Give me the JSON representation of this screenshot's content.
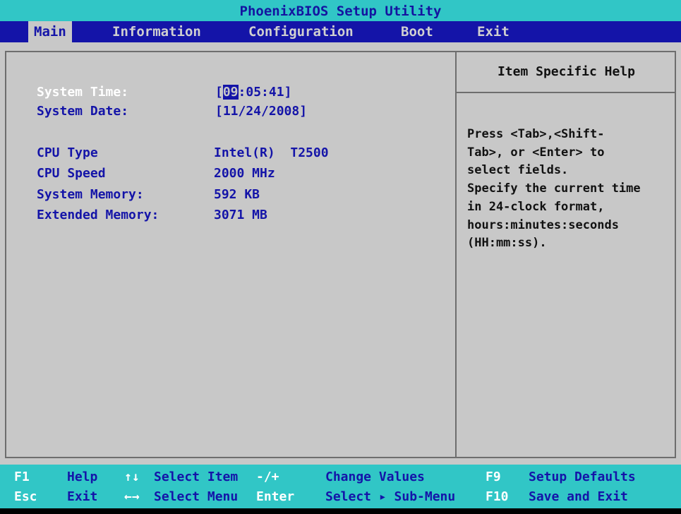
{
  "title": "PhoenixBIOS Setup Utility",
  "menu": {
    "items": [
      {
        "label": "Main"
      },
      {
        "label": "Information"
      },
      {
        "label": "Configuration"
      },
      {
        "label": "Boot"
      },
      {
        "label": "Exit"
      }
    ],
    "active": "Main"
  },
  "main": {
    "system_time": {
      "label": "System Time:",
      "bracket_open": "[",
      "hour": "09",
      "rest": ":05:41",
      "bracket_close": "]"
    },
    "system_date": {
      "label": "System Date:",
      "value": "[11/24/2008]"
    },
    "cpu_type": {
      "label": "CPU Type",
      "value": "Intel(R)  T2500"
    },
    "cpu_speed": {
      "label": "CPU Speed",
      "value": "2000 MHz"
    },
    "system_memory": {
      "label": "System Memory:",
      "value": "592 KB"
    },
    "extended_memory": {
      "label": "Extended Memory:",
      "value": "3071 MB"
    }
  },
  "help": {
    "title": "Item Specific Help",
    "text": "Press <Tab>,<Shift-\nTab>, or <Enter> to\nselect fields.\nSpecify the current time\nin 24-clock format,\nhours:minutes:seconds\n(HH:mm:ss)."
  },
  "footer": {
    "row1": [
      {
        "key": "F1",
        "desc": "Help"
      },
      {
        "key": "↑↓",
        "desc": "Select Item"
      },
      {
        "key": "-/+",
        "desc": "Change Values"
      },
      {
        "key": "F9",
        "desc": "Setup Defaults"
      }
    ],
    "row2": [
      {
        "key": "Esc",
        "desc": "Exit"
      },
      {
        "key": "←→",
        "desc": "Select Menu"
      },
      {
        "key": "Enter",
        "desc": "Select ▸ Sub-Menu"
      },
      {
        "key": "F10",
        "desc": "Save and Exit"
      }
    ]
  },
  "colors": {
    "cyan_bar": "#31c6c6",
    "blue": "#1414a8",
    "gray_bg": "#c8c8c8",
    "white_text": "#ffffff"
  }
}
